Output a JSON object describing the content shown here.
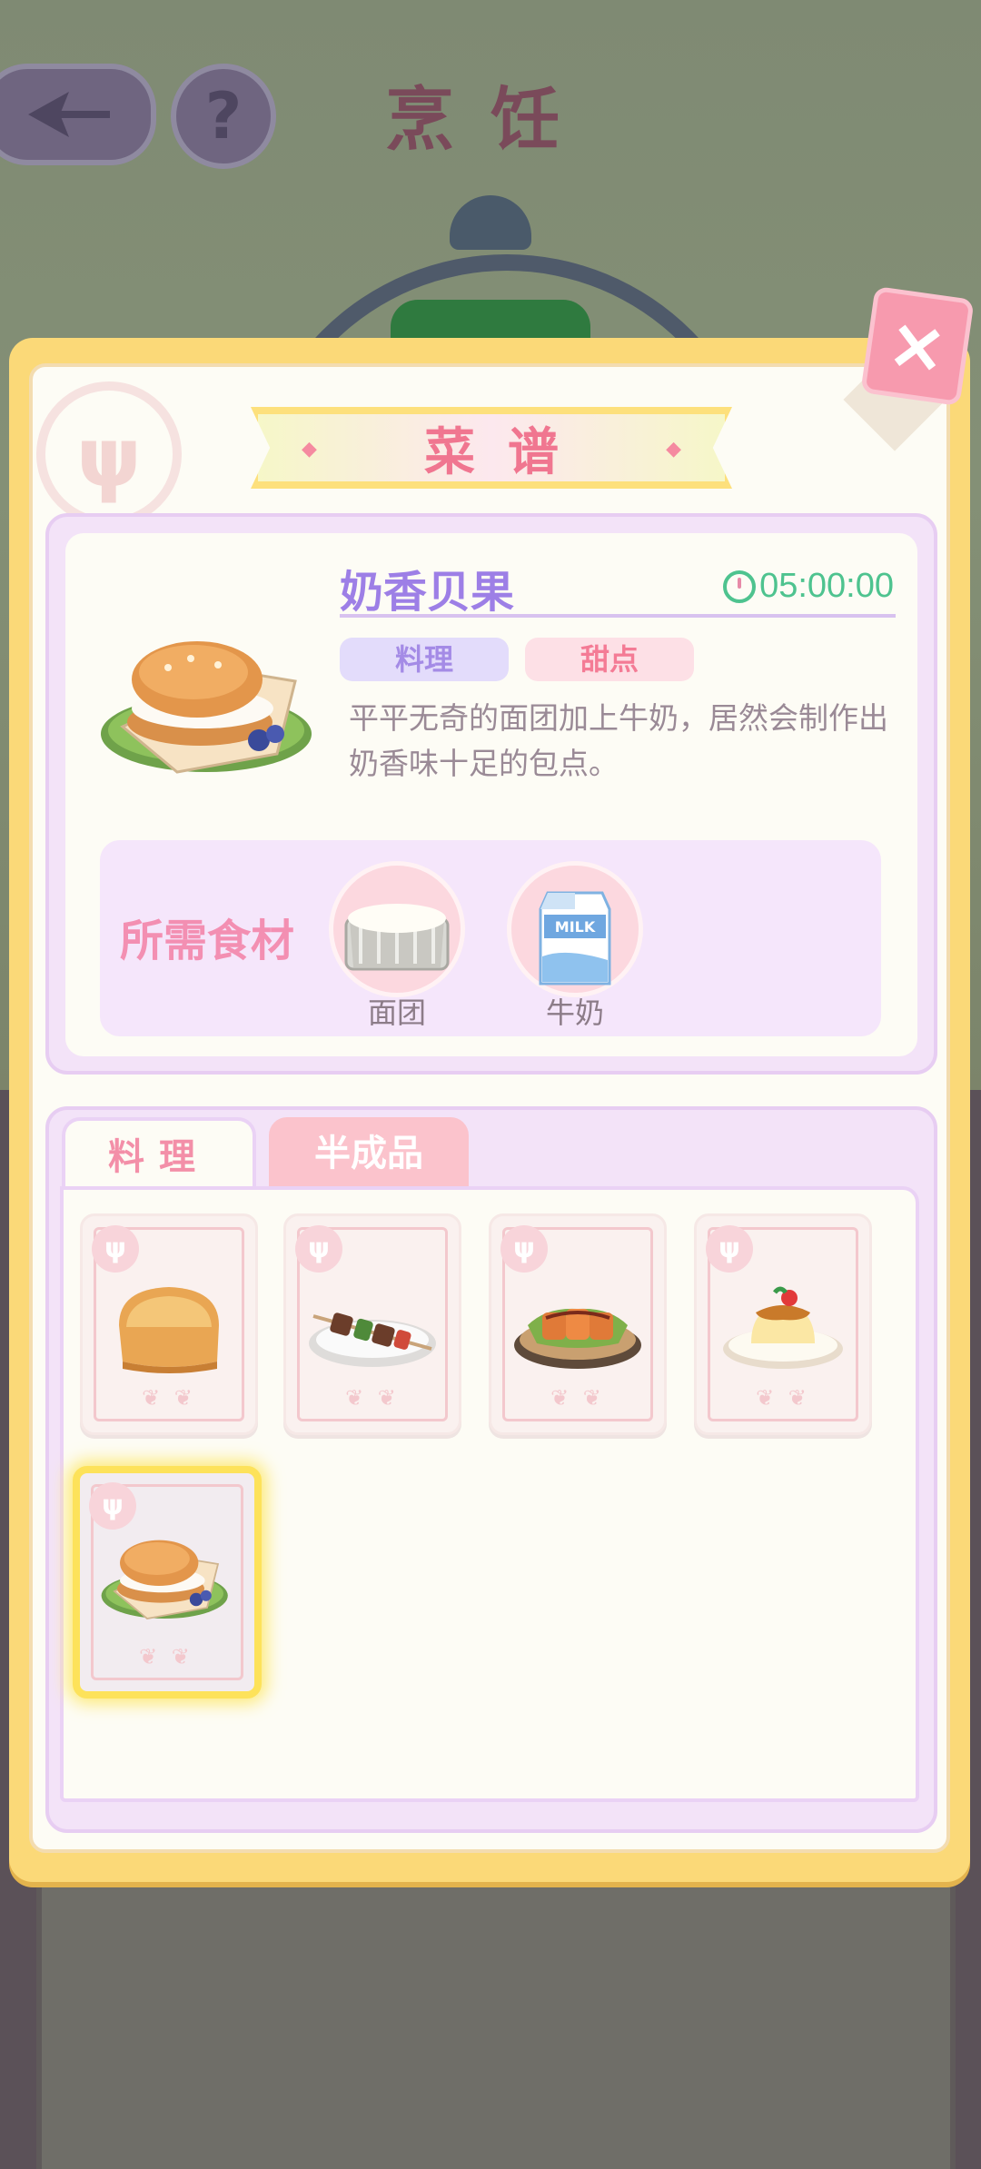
{
  "background": {
    "title": "烹饪",
    "help_label": "?"
  },
  "panel": {
    "title": "菜谱",
    "close_label": "×"
  },
  "detail": {
    "dish_name": "奶香贝果",
    "time": "05:00:00",
    "tags": [
      "料理",
      "甜点"
    ],
    "description": "平平无奇的面团加上牛奶，居然会制作出奶香味十足的包点。",
    "ingredients_label": "所需食材",
    "ingredients": [
      {
        "name": "面团",
        "icon": "dough-icon"
      },
      {
        "name": "牛奶",
        "icon": "milk-carton-icon",
        "carton_text": "MILK"
      }
    ]
  },
  "tabs": [
    {
      "label": "料理",
      "active": true
    },
    {
      "label": "半成品",
      "active": false
    }
  ],
  "recipes": [
    {
      "icon": "bread-icon",
      "selected": false
    },
    {
      "icon": "skewer-icon",
      "selected": false
    },
    {
      "icon": "fried-chicken-icon",
      "selected": false
    },
    {
      "icon": "pudding-icon",
      "selected": false
    },
    {
      "icon": "bagel-icon",
      "selected": true
    }
  ],
  "colors": {
    "panel_border": "#fbd978",
    "accent_pink": "#f38fa8",
    "accent_purple": "#9d7fe6",
    "timer_green": "#4ec38f"
  }
}
